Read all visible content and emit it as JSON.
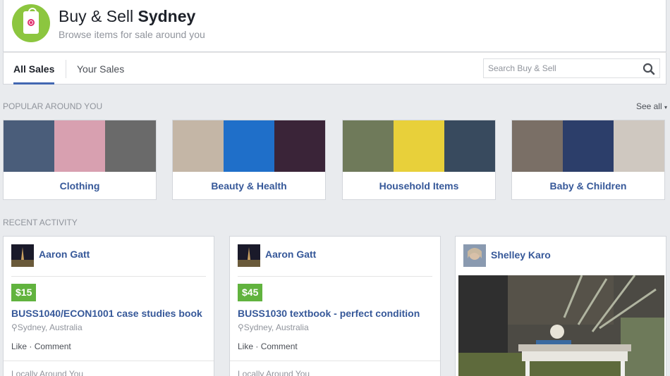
{
  "header": {
    "title_prefix": "Buy & Sell",
    "title_city": "Sydney",
    "subtitle": "Browse items for sale around you"
  },
  "tabs": [
    {
      "label": "All Sales",
      "active": true
    },
    {
      "label": "Your Sales",
      "active": false
    }
  ],
  "search": {
    "placeholder": "Search Buy & Sell"
  },
  "popular": {
    "heading": "POPULAR AROUND YOU",
    "see_all": "See all",
    "categories": [
      {
        "label": "Clothing",
        "thumb_colors": [
          "#4a5d7a",
          "#d8a0b0",
          "#6a6a6a"
        ]
      },
      {
        "label": "Beauty & Health",
        "thumb_colors": [
          "#c4b6a6",
          "#1f6fc9",
          "#3a2438"
        ]
      },
      {
        "label": "Household Items",
        "thumb_colors": [
          "#6f7a5a",
          "#e8d03a",
          "#384a5e"
        ]
      },
      {
        "label": "Baby & Children",
        "thumb_colors": [
          "#7a6f66",
          "#2c3e6a",
          "#cfc8c0"
        ]
      }
    ]
  },
  "recent": {
    "heading": "RECENT ACTIVITY",
    "cards": [
      {
        "user": "Aaron Gatt",
        "price": "$15",
        "title": "BUSS1040/ECON1001 case studies book",
        "location": "Sydney, Australia",
        "like": "Like",
        "comment": "Comment",
        "footer": "Locally Around You"
      },
      {
        "user": "Aaron Gatt",
        "price": "$45",
        "title": "BUSS1030 textbook - perfect condition",
        "location": "Sydney, Australia",
        "like": "Like",
        "comment": "Comment",
        "footer": "Locally Around You"
      },
      {
        "user": "Shelley Karo"
      }
    ]
  },
  "colors": {
    "link": "#365899",
    "price_badge": "#61b33e",
    "logo": "#8cc63f",
    "tab_underline": "#4267b2"
  }
}
